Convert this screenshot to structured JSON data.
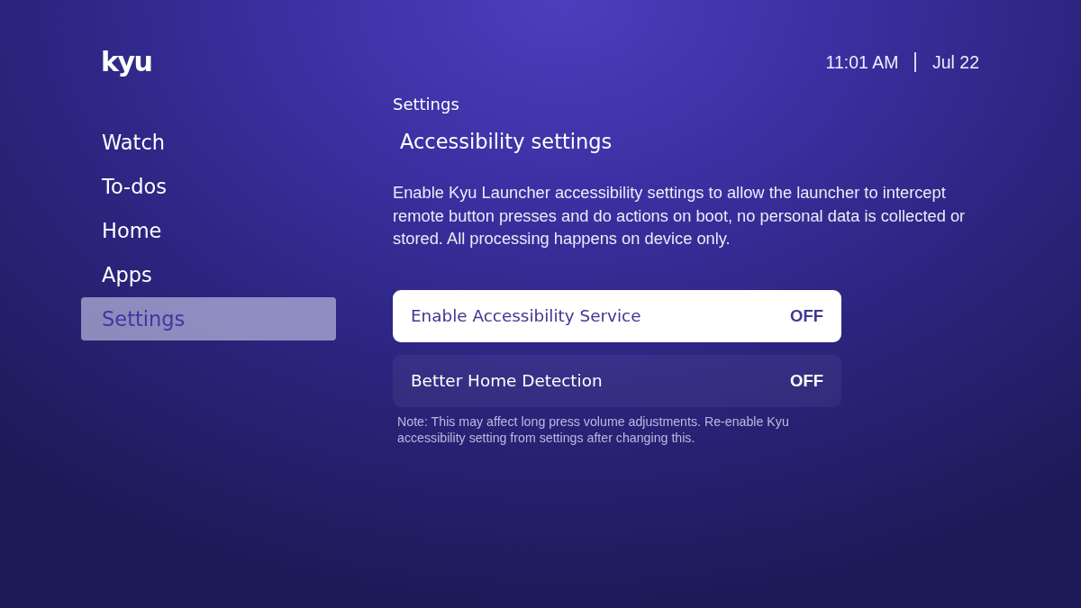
{
  "header": {
    "logo": "kyu",
    "time": "11:01 AM",
    "date": "Jul 22"
  },
  "sidebar": {
    "items": [
      {
        "label": "Watch",
        "selected": false
      },
      {
        "label": "To-dos",
        "selected": false
      },
      {
        "label": "Home",
        "selected": false
      },
      {
        "label": "Apps",
        "selected": false
      },
      {
        "label": "Settings",
        "selected": true
      }
    ]
  },
  "content": {
    "breadcrumb": "Settings",
    "title": "Accessibility settings",
    "description": "Enable Kyu Launcher accessibility settings to allow the launcher to intercept remote button presses and do actions on boot, no personal data is collected or stored. All processing happens on device only.",
    "options": [
      {
        "label": "Enable Accessibility Service",
        "value": "OFF",
        "selected": true
      },
      {
        "label": "Better Home Detection",
        "value": "OFF",
        "selected": false
      }
    ],
    "note": "Note: This may affect long press volume adjustments. Re-enable Kyu accessibility setting from settings after changing this."
  }
}
